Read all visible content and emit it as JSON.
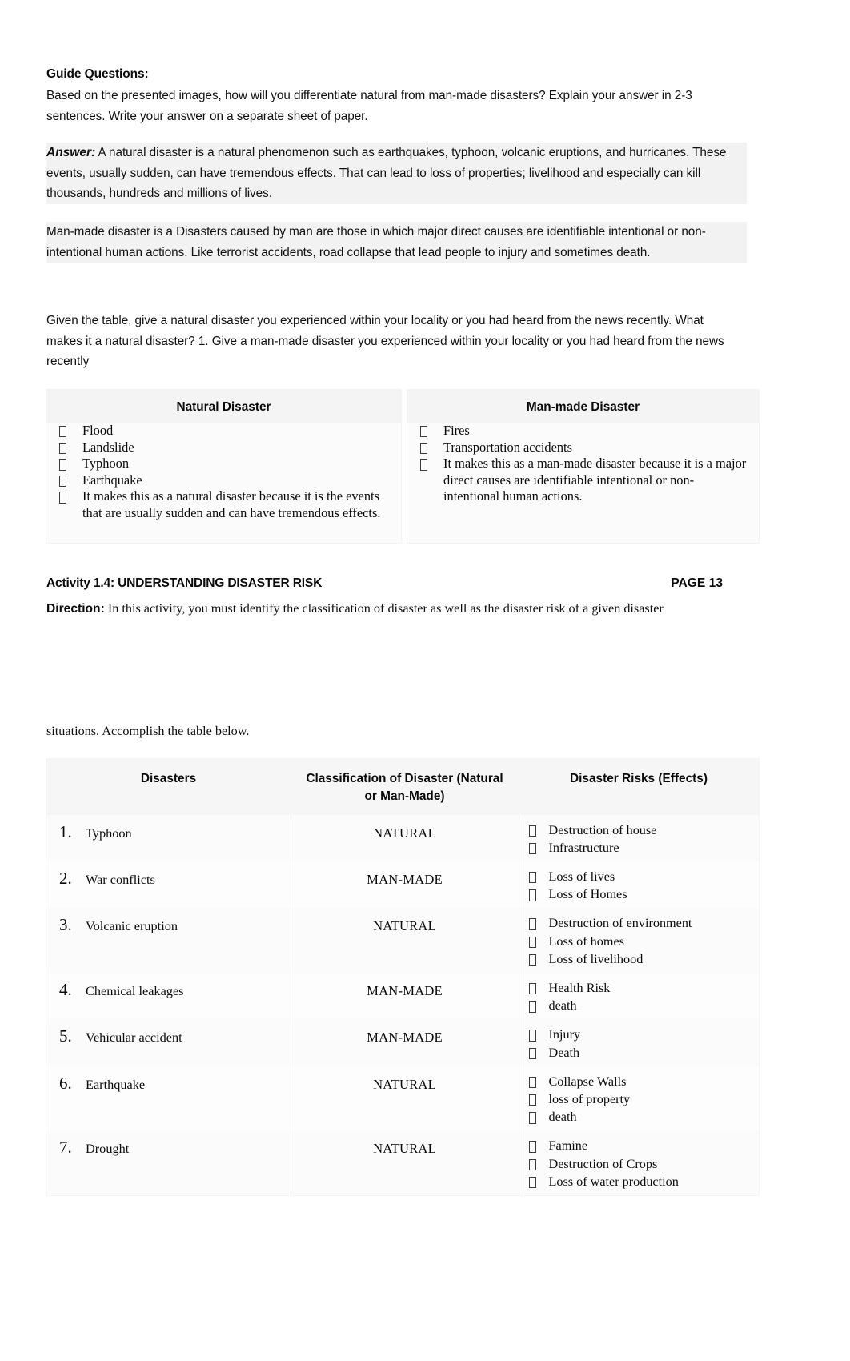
{
  "document": {
    "guide_title": "Guide Questions:",
    "guide_question": "Based on the presented images, how will you differentiate natural from man-made disasters? Explain your answer in 2-3 sentences. Write your answer on a separate sheet of paper.",
    "answer_label": "Answer:",
    "answer_text": " A natural disaster is a natural phenomenon such as earthquakes, typhoon, volcanic eruptions, and hurricanes. These events, usually sudden, can have tremendous effects. That can lead to loss of properties; livelihood and especially can kill thousands, hundreds and millions of lives.",
    "manmade_text": "Man-made disaster is a Disasters caused by man are those in which major direct causes are identifiable intentional or non-intentional human actions. Like terrorist accidents, road collapse that lead people to injury and sometimes death.",
    "given_text": "Given the table, give a natural disaster you experienced within your locality or you had heard from the news recently. What makes it a natural disaster? 1. Give a man-made disaster you experienced within your locality or you had heard from the news recently"
  },
  "table_one": {
    "natural": {
      "header": "Natural Disaster",
      "items": [
        "Flood",
        "Landslide",
        "Typhoon",
        "Earthquake",
        "It makes this as a natural disaster because it is the events that are usually sudden and can have tremendous effects."
      ]
    },
    "manmade": {
      "header": "Man-made Disaster",
      "items": [
        "Fires",
        "Transportation accidents",
        "It makes this as a man-made disaster because it is a major direct causes are identifiable intentional or non-intentional human actions."
      ]
    }
  },
  "activity": {
    "title": "Activity 1.4: UNDERSTANDING DISASTER RISK",
    "page_label": "PAGE 13",
    "direction_label": "Direction:",
    "direction_text": " In this activity, you must identify the classification of disaster as well as the disaster risk of a given disaster",
    "situations_text": "situations. Accomplish the table below."
  },
  "table_two": {
    "headers": [
      "Disasters",
      "Classification of Disaster (Natural or Man-Made)",
      "Disaster Risks (Effects)"
    ],
    "rows": [
      {
        "number": "1.",
        "disaster": "Typhoon",
        "classification": "NATURAL",
        "risks": [
          "Destruction of house",
          "Infrastructure"
        ]
      },
      {
        "number": "2.",
        "disaster": "War conflicts",
        "classification": "MAN-MADE",
        "risks": [
          "Loss of lives",
          "Loss of Homes"
        ]
      },
      {
        "number": "3.",
        "disaster": "Volcanic eruption",
        "classification": "NATURAL",
        "risks": [
          "Destruction of environment",
          "Loss of homes",
          "Loss of livelihood"
        ]
      },
      {
        "number": "4.",
        "disaster": "Chemical leakages",
        "classification": "MAN-MADE",
        "risks": [
          "Health Risk",
          "death"
        ]
      },
      {
        "number": "5.",
        "disaster": "Vehicular accident",
        "classification": "MAN-MADE",
        "risks": [
          "Injury",
          "Death"
        ]
      },
      {
        "number": "6.",
        "disaster": "Earthquake",
        "classification": "NATURAL",
        "risks": [
          "Collapse Walls",
          "loss of property",
          "death"
        ]
      },
      {
        "number": "7.",
        "disaster": "Drought",
        "classification": "NATURAL",
        "risks": [
          "Famine",
          "Destruction of Crops",
          "Loss of water production"
        ]
      }
    ]
  }
}
